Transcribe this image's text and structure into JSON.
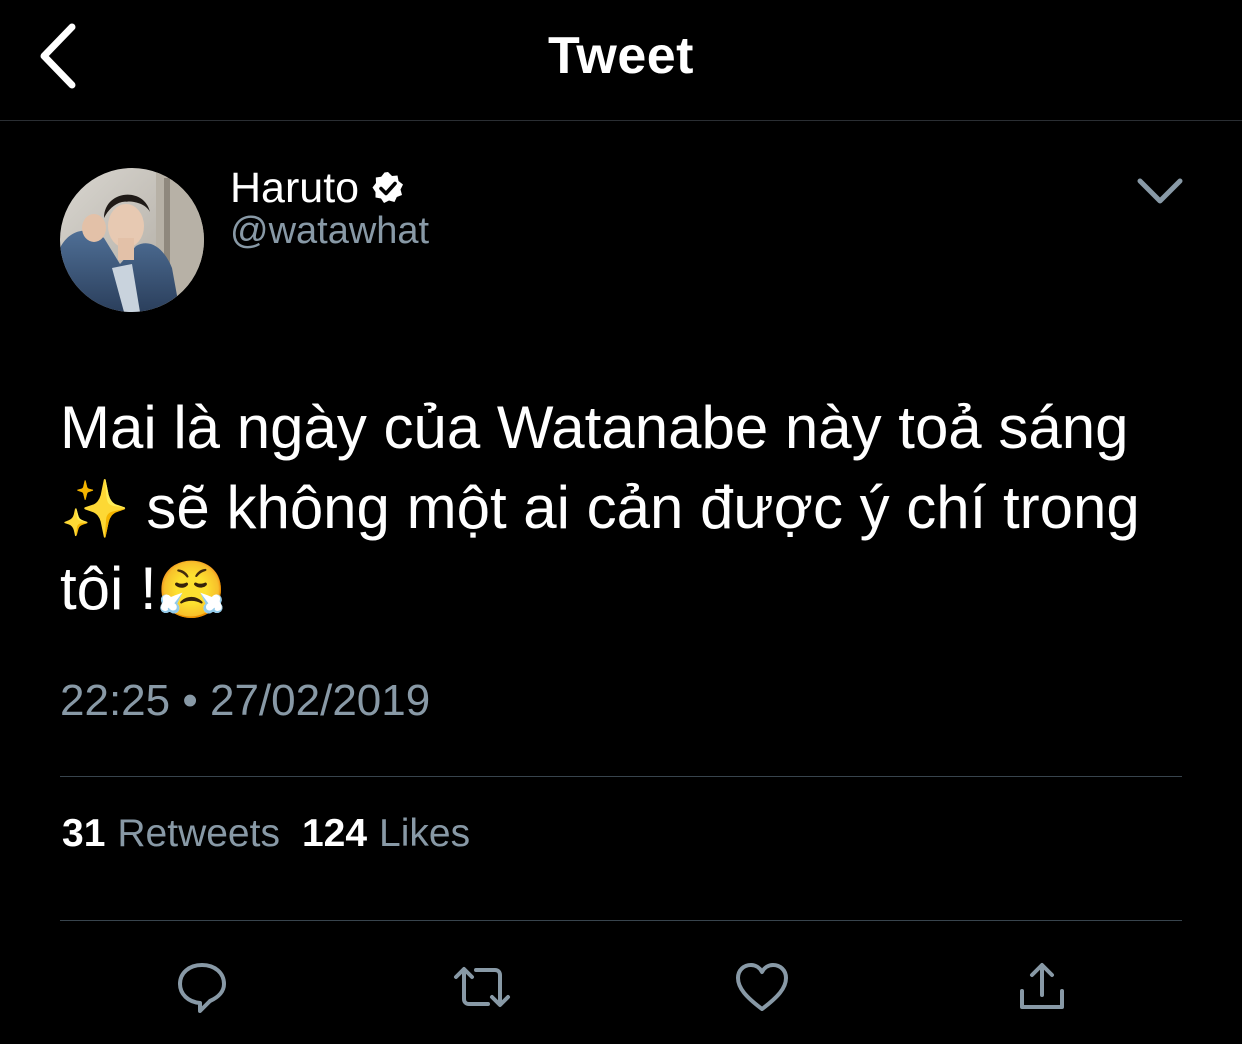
{
  "header": {
    "title": "Tweet",
    "back_icon": "chevron-left-icon"
  },
  "author": {
    "display_name": "Haruto",
    "handle": "@watawhat",
    "verified": true,
    "verified_icon": "verified-badge-icon",
    "menu_icon": "chevron-down-icon"
  },
  "tweet": {
    "line1": "Mai là ngày của Watanabe này toả sáng",
    "line2_emoji": "✨",
    "line2_text": " sẽ không một ai cản được ý chí trong",
    "line3_text": "tôi !",
    "line3_emoji": "😤",
    "time": "22:25",
    "separator": "•",
    "date": "27/02/2019"
  },
  "stats": {
    "retweets_count": "31",
    "retweets_label": "Retweets",
    "likes_count": "124",
    "likes_label": "Likes"
  },
  "actions": [
    {
      "name": "reply",
      "icon": "reply-icon"
    },
    {
      "name": "retweet",
      "icon": "retweet-icon"
    },
    {
      "name": "like",
      "icon": "heart-icon"
    },
    {
      "name": "share",
      "icon": "share-icon"
    }
  ],
  "colors": {
    "background": "#000000",
    "text_primary": "#ffffff",
    "text_secondary": "#8899a6",
    "divider": "#38444d"
  }
}
